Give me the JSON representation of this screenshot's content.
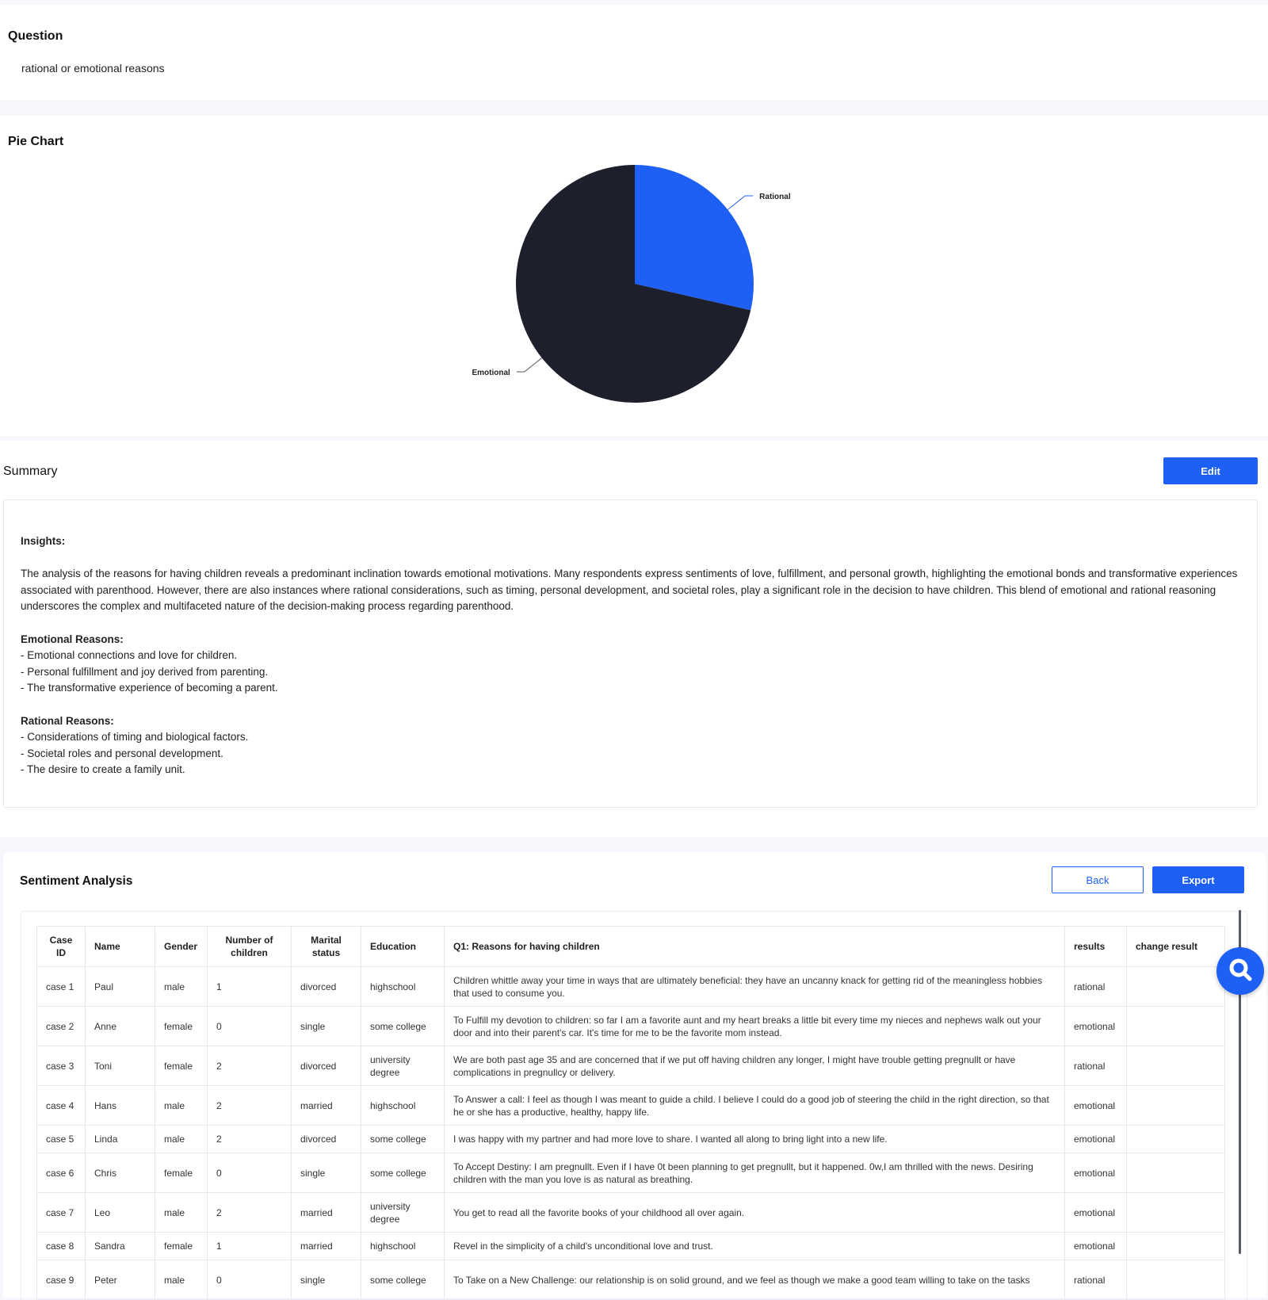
{
  "question": {
    "title": "Question",
    "text": "rational or emotional reasons"
  },
  "pie_section": {
    "title": "Pie Chart"
  },
  "chart_data": {
    "type": "pie",
    "labels": [
      "Rational",
      "Emotional"
    ],
    "values": [
      2,
      5
    ],
    "colors": [
      "#1e5ff5",
      "#1e1f2c"
    ]
  },
  "summary": {
    "title": "Summary",
    "edit_label": "Edit",
    "insights_heading": "Insights:",
    "insights_text": "The analysis of the reasons for having children reveals a predominant inclination towards emotional motivations. Many respondents express sentiments of love, fulfillment, and personal growth, highlighting the emotional bonds and transformative experiences associated with parenthood. However, there are also instances where rational considerations, such as timing, personal development, and societal roles, play a significant role in the decision to have children. This blend of emotional and rational reasoning underscores the complex and multifaceted nature of the decision-making process regarding parenthood.",
    "emotional_heading": "Emotional Reasons:",
    "emotional_items": [
      "- Emotional connections and love for children.",
      "- Personal fulfillment and joy derived from parenting.",
      "- The transformative experience of becoming a parent."
    ],
    "rational_heading": "Rational Reasons:",
    "rational_items": [
      "- Considerations of timing and biological factors.",
      "- Societal roles and personal development.",
      "- The desire to create a family unit."
    ]
  },
  "sentiment": {
    "title": "Sentiment Analysis",
    "back_label": "Back",
    "export_label": "Export",
    "columns": [
      "Case ID",
      "Name",
      "Gender",
      "Number of children",
      "Marital status",
      "Education",
      "Q1: Reasons for having children",
      "results",
      "change result"
    ],
    "rows": [
      [
        "case 1",
        "Paul",
        "male",
        "1",
        "divorced",
        "highschool",
        "Children whittle away your time in ways that are ultimately beneficial: they have an uncanny knack for getting rid of the meaningless hobbies that used to consume you.",
        "rational",
        ""
      ],
      [
        "case 2",
        "Anne",
        "female",
        "0",
        "single",
        "some college",
        "To Fulfill my devotion to children: so far I am a favorite aunt and my heart breaks a little bit every time my nieces and nephews walk out your door and into their parent's car. It's time for me to be the favorite mom instead.",
        "emotional",
        ""
      ],
      [
        "case 3",
        "Toni",
        "female",
        "2",
        "divorced",
        "university degree",
        "We are both past age 35 and are concerned that if we put off having children any longer, I might have trouble getting pregnullt or have complications in pregnullcy or delivery.",
        "rational",
        ""
      ],
      [
        "case 4",
        "Hans",
        "male",
        "2",
        "married",
        "highschool",
        "To Answer a call: I feel as though I was meant to guide a child. I believe I could do a good job of steering the child in the right direction, so that he or she has a productive, healthy, happy life.",
        "emotional",
        ""
      ],
      [
        "case 5",
        "Linda",
        "male",
        "2",
        "divorced",
        "some college",
        "I was happy with my partner and had more love to share. I wanted all along to bring light into a new life.",
        "emotional",
        ""
      ],
      [
        "case 6",
        "Chris",
        "female",
        "0",
        "single",
        "some college",
        "To Accept Destiny: I am pregnullt. Even if I have 0t been planning to get pregnullt, but it happened. 0w,I am thrilled with the news. Desiring children with the man you love is as natural as breathing.",
        "emotional",
        ""
      ],
      [
        "case 7",
        "Leo",
        "male",
        "2",
        "married",
        "university degree",
        "You get to read all the favorite books of your childhood all over again.",
        "emotional",
        ""
      ],
      [
        "case 8",
        "Sandra",
        "female",
        "1",
        "married",
        "highschool",
        "Revel in the simplicity of a child's unconditional love and trust.",
        "emotional",
        ""
      ],
      [
        "case 9",
        "Peter",
        "male",
        "0",
        "single",
        "some college",
        "To Take on a New Challenge: our relationship is on solid ground, and we feel as though we make a good team willing to take on the tasks",
        "rational",
        ""
      ]
    ]
  }
}
